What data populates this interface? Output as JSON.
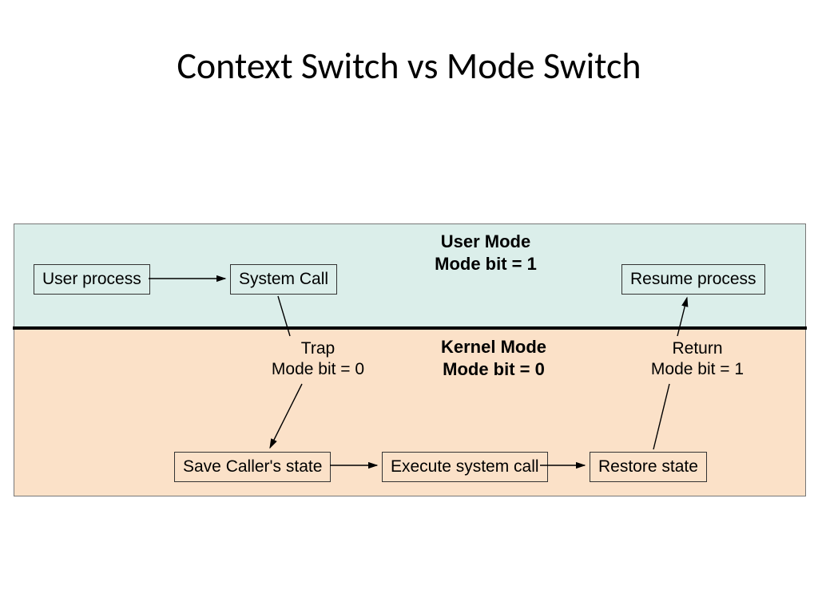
{
  "title": "Context Switch vs Mode Switch",
  "user_mode_header": {
    "line1": "User Mode",
    "line2": "Mode bit = 1"
  },
  "kernel_mode_header": {
    "line1": "Kernel Mode",
    "line2": "Mode bit = 0"
  },
  "nodes": {
    "user_process": "User process",
    "system_call": "System Call",
    "resume_process": "Resume process",
    "save_state": "Save Caller's state",
    "execute_syscall": "Execute system call",
    "restore_state": "Restore state"
  },
  "labels": {
    "trap": {
      "line1": "Trap",
      "line2": "Mode bit = 0"
    },
    "return": {
      "line1": "Return",
      "line2": "Mode bit = 1"
    }
  },
  "colors": {
    "user_bg": "#dbeeea",
    "kernel_bg": "#fbe1c8"
  }
}
